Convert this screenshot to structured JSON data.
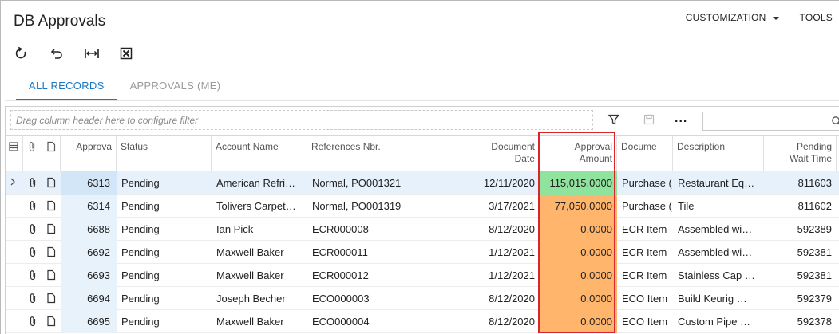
{
  "page": {
    "title": "DB Approvals",
    "menu": [
      {
        "label": "CUSTOMIZATION",
        "has_caret": true
      },
      {
        "label": "TOOLS",
        "has_caret": false
      }
    ]
  },
  "toolbar": {
    "icons": [
      "refresh-icon",
      "undo-icon",
      "fit-to-screen-icon",
      "excel-export-icon"
    ]
  },
  "tabs": [
    {
      "label": "ALL RECORDS",
      "active": true
    },
    {
      "label": "APPROVALS (ME)",
      "active": false
    }
  ],
  "grid": {
    "filter_placeholder": "Drag column header here to configure filter",
    "more_label": "...",
    "columns": [
      {
        "key": "approval",
        "label": "Approva"
      },
      {
        "key": "status",
        "label": "Status"
      },
      {
        "key": "account",
        "label": "Account Name"
      },
      {
        "key": "ref",
        "label": "References Nbr."
      },
      {
        "key": "date",
        "label": "Document\nDate"
      },
      {
        "key": "amount",
        "label": "Approval\nAmount"
      },
      {
        "key": "doc",
        "label": "Docume"
      },
      {
        "key": "desc",
        "label": "Description"
      },
      {
        "key": "wait",
        "label": "Pending\nWait Time"
      }
    ],
    "rows": [
      {
        "approval": "6313",
        "status": "Pending",
        "account": "American Refri…",
        "ref": "Normal, PO001321",
        "date": "12/11/2020",
        "amount": "115,015.0000",
        "doc": "Purchase (",
        "desc": "Restaurant Eq…",
        "wait": "811603",
        "amount_color": "#8fe39d",
        "selected": true
      },
      {
        "approval": "6314",
        "status": "Pending",
        "account": "Tolivers Carpet…",
        "ref": "Normal, PO001319",
        "date": "3/17/2021",
        "amount": "77,050.0000",
        "doc": "Purchase (",
        "desc": "Tile",
        "wait": "811602",
        "amount_color": "#ffb56b",
        "selected": false
      },
      {
        "approval": "6688",
        "status": "Pending",
        "account": "Ian Pick",
        "ref": "ECR000008",
        "date": "8/12/2020",
        "amount": "0.0000",
        "doc": "ECR Item",
        "desc": "Assembled wi…",
        "wait": "592389",
        "amount_color": "#ffb56b",
        "selected": false
      },
      {
        "approval": "6692",
        "status": "Pending",
        "account": "Maxwell Baker",
        "ref": "ECR000011",
        "date": "1/12/2021",
        "amount": "0.0000",
        "doc": "ECR Item",
        "desc": "Assembled wi…",
        "wait": "592381",
        "amount_color": "#ffb56b",
        "selected": false
      },
      {
        "approval": "6693",
        "status": "Pending",
        "account": "Maxwell Baker",
        "ref": "ECR000012",
        "date": "1/12/2021",
        "amount": "0.0000",
        "doc": "ECR Item",
        "desc": "Stainless Cap …",
        "wait": "592381",
        "amount_color": "#ffb56b",
        "selected": false
      },
      {
        "approval": "6694",
        "status": "Pending",
        "account": "Joseph Becher",
        "ref": "ECO000003",
        "date": "8/12/2020",
        "amount": "0.0000",
        "doc": "ECO Item",
        "desc": "Build Keurig …",
        "wait": "592379",
        "amount_color": "#ffb56b",
        "selected": false
      },
      {
        "approval": "6695",
        "status": "Pending",
        "account": "Maxwell Baker",
        "ref": "ECO000004",
        "date": "8/12/2020",
        "amount": "0.0000",
        "doc": "ECO Item",
        "desc": "Custom Pipe …",
        "wait": "592378",
        "amount_color": "#ffb56b",
        "selected": false
      }
    ]
  },
  "colors": {
    "accent": "#1a78c2",
    "highlight_border": "#d9262c",
    "selected_row": "#e6f1fb"
  }
}
